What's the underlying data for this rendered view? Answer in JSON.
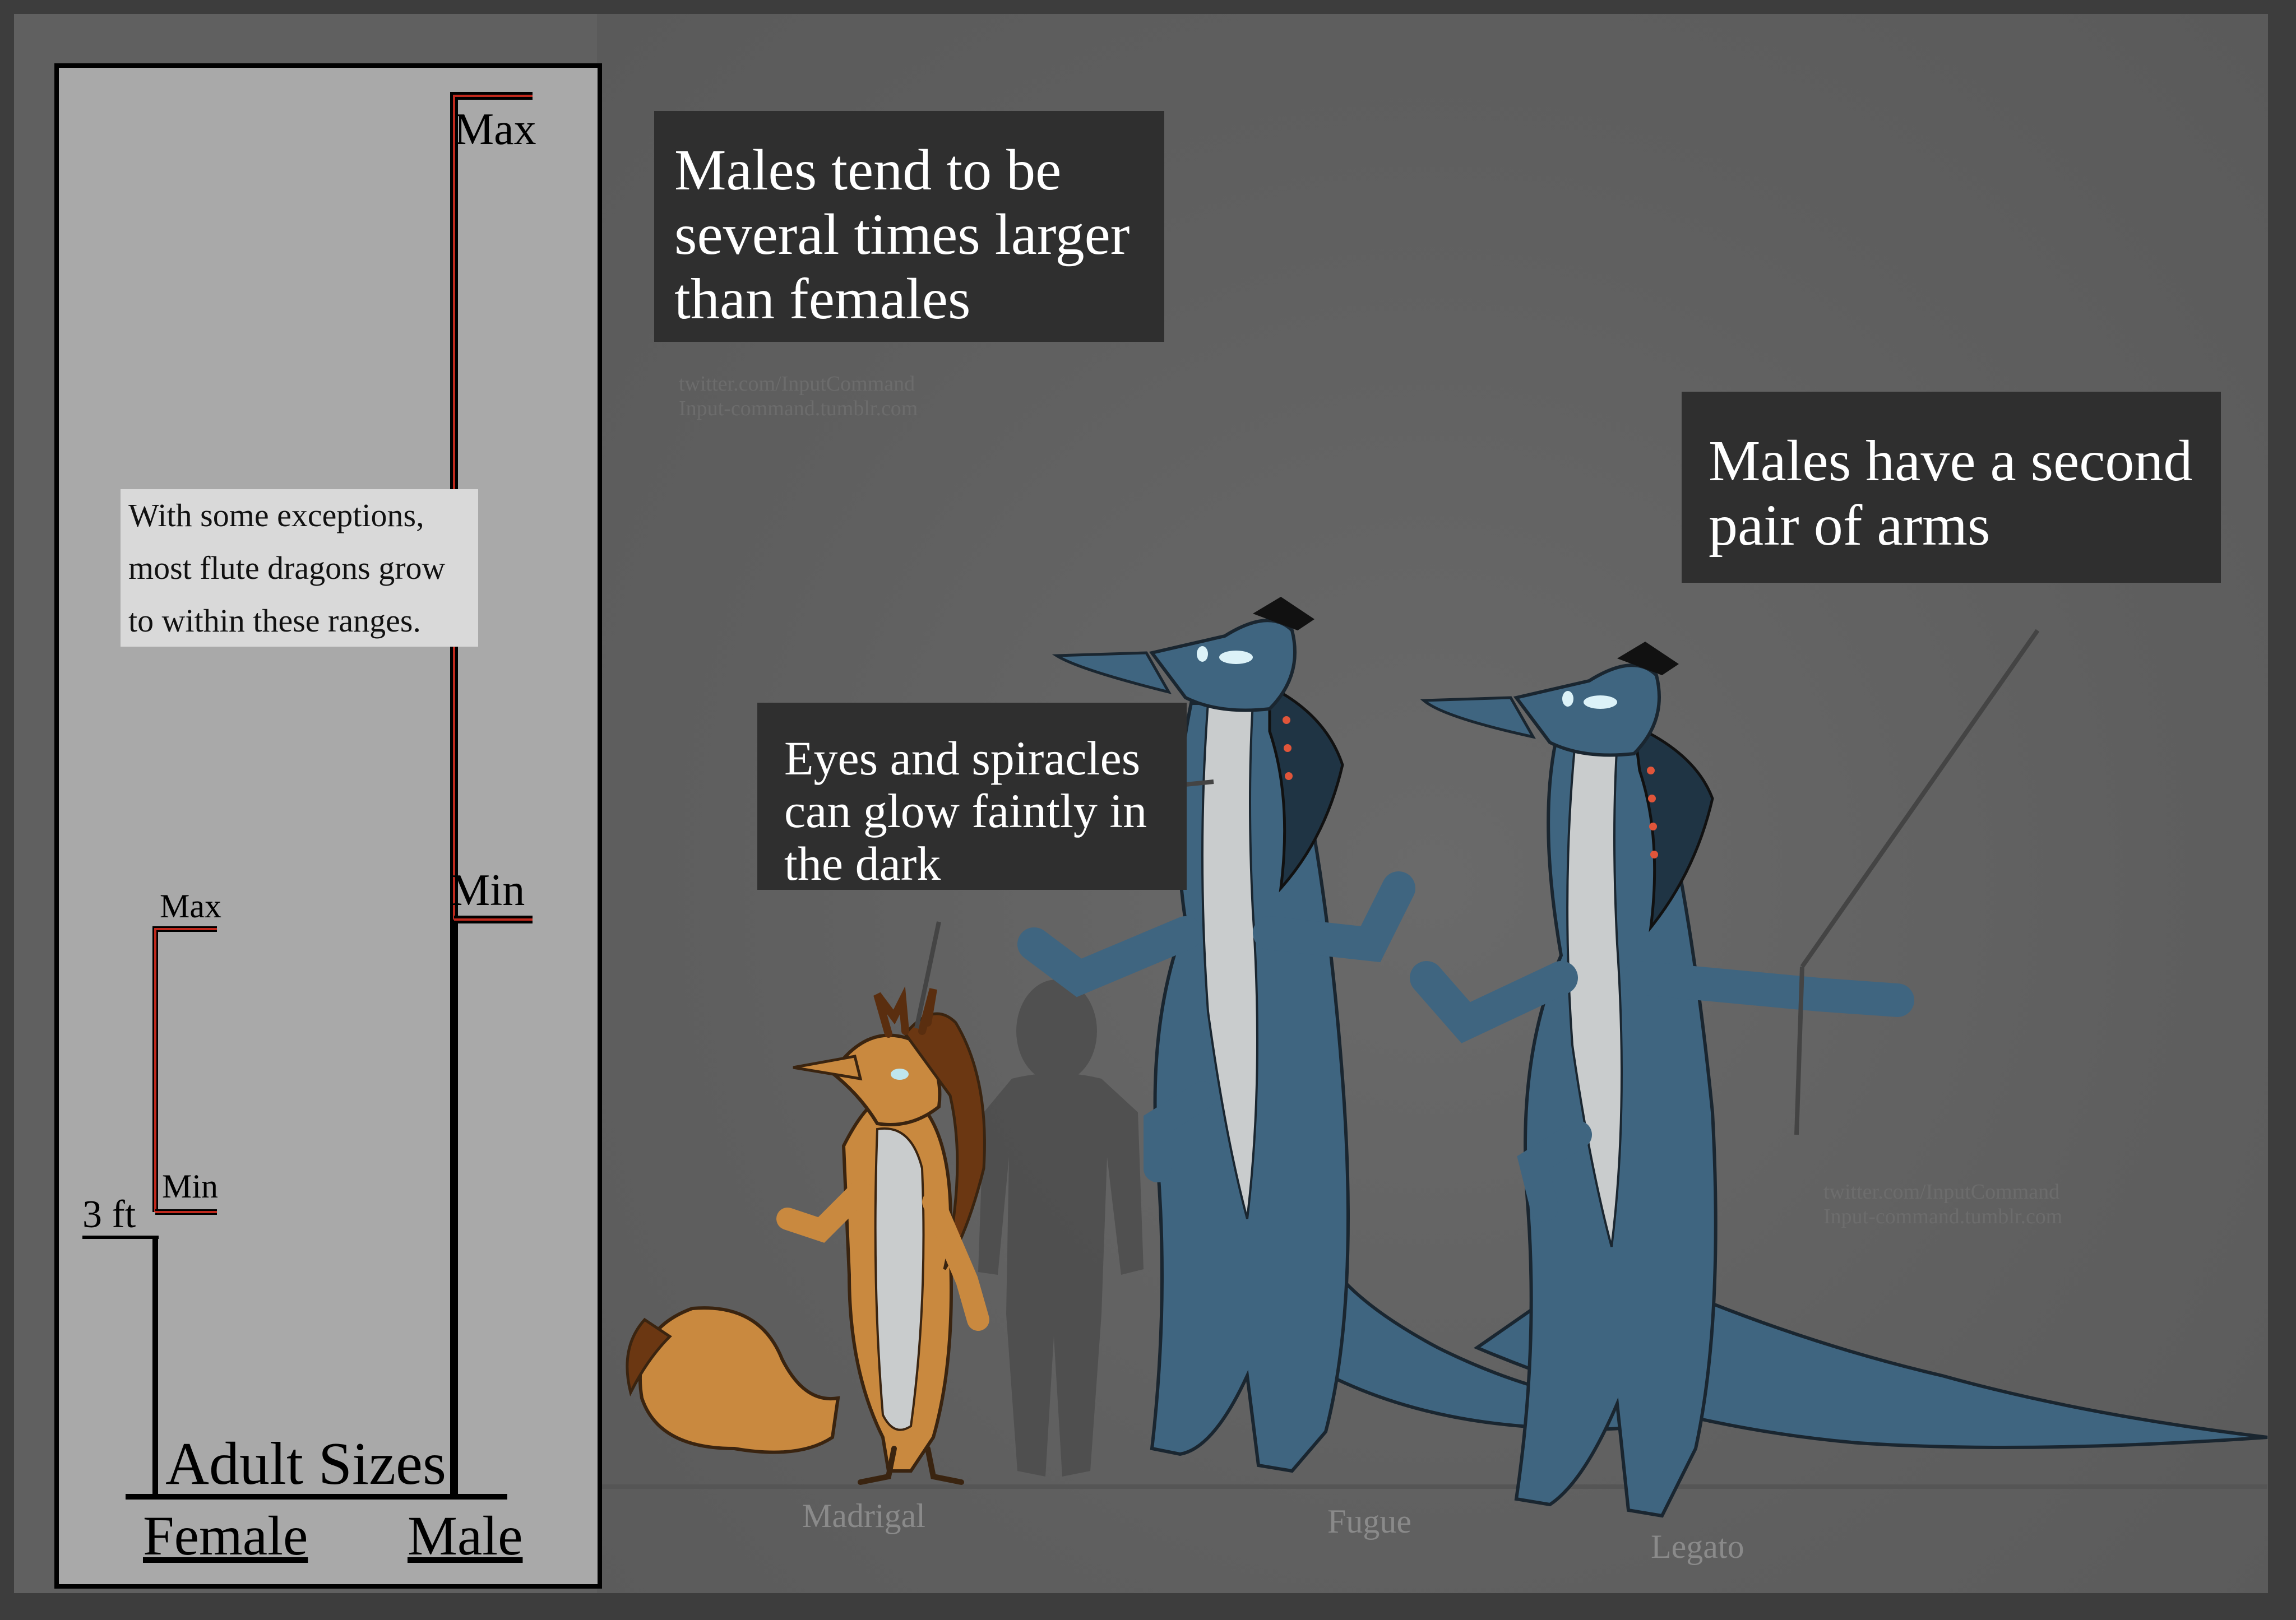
{
  "chart_panel": {
    "title": "Adult Sizes",
    "female_label": "Female",
    "male_label": "Male",
    "three_ft_label": "3 ft",
    "female_max_label": "Max",
    "female_min_label": "Min",
    "male_max_label": "Max",
    "male_min_label": "Min",
    "note_lines": [
      "With some exceptions,",
      "most flute dragons grow",
      "to within these ranges."
    ]
  },
  "chart_data": {
    "type": "bar",
    "title": "Adult Sizes",
    "categories": [
      "Female",
      "Male"
    ],
    "reference_line_label": "3 ft",
    "ranges": [
      {
        "name": "Female",
        "min_label": "Min",
        "max_label": "Max"
      },
      {
        "name": "Male",
        "min_label": "Min",
        "max_label": "Max"
      }
    ]
  },
  "callouts": {
    "size": [
      "Males tend to be",
      "several times larger",
      "than females"
    ],
    "arms": [
      "Males have a second",
      "pair of arms"
    ],
    "glow": [
      "Eyes and spiracles",
      "can glow faintly in",
      "the dark"
    ]
  },
  "characters": {
    "madrigal": "Madrigal",
    "fugue": "Fugue",
    "legato": "Legato"
  },
  "watermarks": {
    "top": [
      "twitter.com/InputCommand",
      "Input-command.tumblr.com"
    ],
    "right": [
      "twitter.com/InputCommand",
      "Input-command.tumblr.com"
    ]
  },
  "colors": {
    "background": "#606060",
    "panel": "#a9a9a9",
    "callout": "#2f2f2f",
    "range_red": "#c0291d",
    "male_dragon": "#3f6580",
    "male_dark": "#1f3444",
    "belly": "#c9cccd",
    "female_dragon": "#c9893f",
    "female_dark": "#6b3712",
    "silhouette": "#4e4e4e"
  }
}
